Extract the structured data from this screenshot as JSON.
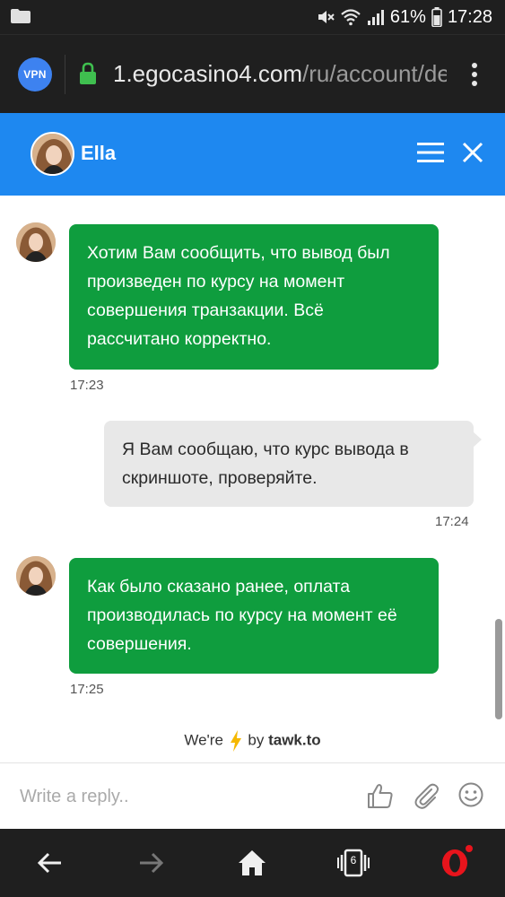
{
  "status_bar": {
    "battery": "61%",
    "time": "17:28"
  },
  "browser": {
    "vpn_label": "VPN",
    "url_host": "1.egocasino4.com",
    "url_path": "/ru/account/de"
  },
  "chat_header": {
    "agent_name": "Ella"
  },
  "messages": [
    {
      "sender": "agent",
      "text": "Хотим Вам сообщить, что вывод был произведен по курсу на момент совершения транзакции. Всё рассчитано корректно.",
      "time": "17:23"
    },
    {
      "sender": "visitor",
      "text": "Я Вам сообщаю, что курс вывода в скриншоте, проверяйте.",
      "time": "17:24"
    },
    {
      "sender": "agent",
      "text": "Как было сказано ранее, оплата производилась по курсу на момент её совершения.",
      "time": "17:25"
    }
  ],
  "powered_by": {
    "prefix": "We're",
    "middle": "by",
    "brand": "tawk.to"
  },
  "reply": {
    "placeholder": "Write a reply.."
  },
  "bottom_nav": {
    "tab_count": "6"
  },
  "colors": {
    "header_blue": "#1e88f0",
    "agent_bubble_green": "#0f9d3e",
    "visitor_bubble_gray": "#e8e8e8",
    "opera_red": "#e8141c"
  }
}
